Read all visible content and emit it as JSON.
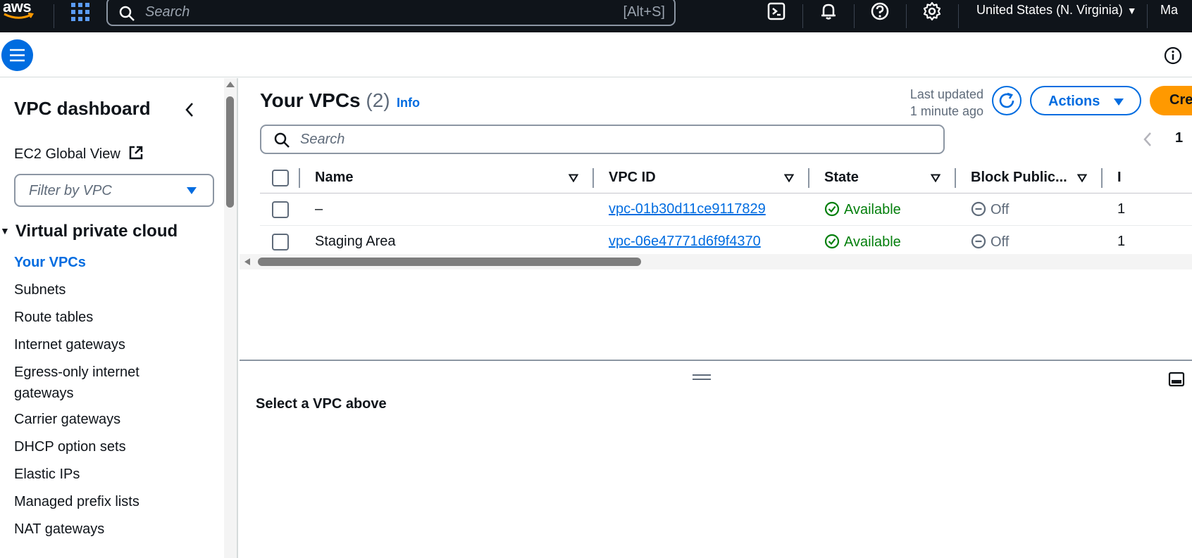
{
  "topnav": {
    "logo_text": "aws",
    "search_placeholder": "Search",
    "search_shortcut": "[Alt+S]",
    "region": "United States (N. Virginia)",
    "user_partial": "Ma"
  },
  "sidebar": {
    "title": "VPC dashboard",
    "ec2_global_view": "EC2 Global View",
    "filter_placeholder": "Filter by VPC",
    "section_title": "Virtual private cloud",
    "items": [
      {
        "label": "Your VPCs",
        "active": true
      },
      {
        "label": "Subnets"
      },
      {
        "label": "Route tables"
      },
      {
        "label": "Internet gateways"
      },
      {
        "label": "Egress-only internet gateways"
      },
      {
        "label": "Carrier gateways"
      },
      {
        "label": "DHCP option sets"
      },
      {
        "label": "Elastic IPs"
      },
      {
        "label": "Managed prefix lists"
      },
      {
        "label": "NAT gateways"
      }
    ]
  },
  "main": {
    "title": "Your VPCs",
    "count": "(2)",
    "info": "Info",
    "last_updated_line1": "Last updated",
    "last_updated_line2": "1 minute ago",
    "actions_label": "Actions",
    "create_label_partial": "Cre",
    "search_placeholder": "Search",
    "page_number": "1",
    "columns": [
      "Name",
      "VPC ID",
      "State",
      "Block Public...",
      "I"
    ],
    "rows": [
      {
        "name": "–",
        "vpc_id": "vpc-01b30d11ce9117829",
        "state": "Available",
        "block_public": "Off",
        "extra": "1"
      },
      {
        "name": "Staging Area",
        "vpc_id": "vpc-06e47771d6f9f4370",
        "state": "Available",
        "block_public": "Off",
        "extra": "1"
      }
    ],
    "detail_message": "Select a VPC above"
  },
  "colors": {
    "nav_bg": "#0f141a",
    "link_blue": "#006ce0",
    "primary_orange": "#ff9900",
    "status_green": "#037f0c"
  }
}
